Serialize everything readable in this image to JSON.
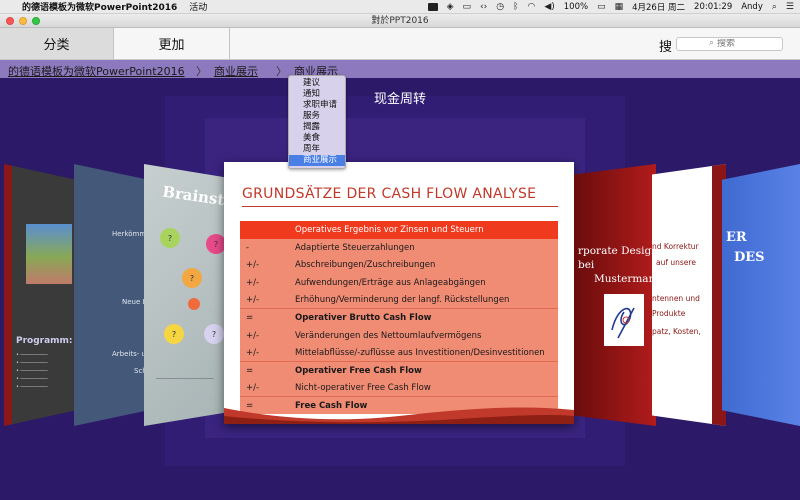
{
  "menubar": {
    "app_title": "的德语模板为微软PowerPoint2016",
    "menu_activity": "活动",
    "battery": "100%",
    "date": "4月26日 周二",
    "time": "20:01:29",
    "user": "Andy"
  },
  "window": {
    "title": "對於PPT2016"
  },
  "toolbar": {
    "tab_category": "分类",
    "tab_more": "更加",
    "search_label": "搜",
    "search_placeholder": "搜索"
  },
  "breadcrumb": {
    "item1": "的德语模板为微软PowerPoint2016",
    "sep": "〉",
    "item2": "商业展示",
    "item3": "商业展示"
  },
  "dropdown": {
    "options": [
      "建议",
      "通知",
      "求职申请",
      "服务",
      "揭露",
      "美食",
      "周年",
      "商业展示"
    ],
    "selected_index": 7
  },
  "stage": {
    "title": "现金周转"
  },
  "slide": {
    "title": "GRUNDSÄTZE DER CASH FLOW ANALYSE",
    "rows": [
      {
        "sym": "",
        "text": "Operatives Ergebnis vor Zinsen und Steuern"
      },
      {
        "sym": "-",
        "text": "Adaptierte Steuerzahlungen"
      },
      {
        "sym": "+/-",
        "text": "Abschreibungen/Zuschreibungen"
      },
      {
        "sym": "+/-",
        "text": "Aufwendungen/Erträge aus Anlageabgängen"
      },
      {
        "sym": "+/-",
        "text": "Erhöhung/Verminderung der langf. Rückstellungen"
      },
      {
        "sym": "=",
        "text": "Operativer Brutto Cash Flow"
      },
      {
        "sym": "+/-",
        "text": "Veränderungen des Nettoumlaufvermögens"
      },
      {
        "sym": "+/-",
        "text": "Mittelabflüsse/-zuflüsse aus Investitionen/Desinvestitionen"
      },
      {
        "sym": "=",
        "text": "Operativer Free Cash Flow"
      },
      {
        "sym": "+/-",
        "text": "Nicht-operativer Free Cash Flow"
      },
      {
        "sym": "=",
        "text": "Free Cash Flow"
      }
    ]
  },
  "side_cards": {
    "l1_program": "Programm:",
    "l2_line1": "Herkömml",
    "l2_line2": "Neue Lö",
    "l2_line3": "Arbeits- u",
    "l2_line4": "Sch",
    "l3_title": "Brainstorming",
    "l3_q": "?",
    "r1_line1": "rporate Design bei",
    "r1_line2": "Mustermann",
    "r2_line1": "nd Korrektur",
    "r2_line2": "auf  unsere",
    "r2_line3": "ntennen und",
    "r2_line4": "Produkte",
    "r2_line5": "patz, Kosten,",
    "r3_line1": "ER",
    "r3_line2": "DES"
  },
  "colors": {
    "stage_bg": "#2c1a69",
    "breadcrumb_bg": "#8d79bd",
    "slide_table_bg": "#f08b74",
    "slide_header_bg": "#ef3a1e",
    "slide_title": "#c0392b",
    "dropdown_selected": "#4a7fe5"
  }
}
